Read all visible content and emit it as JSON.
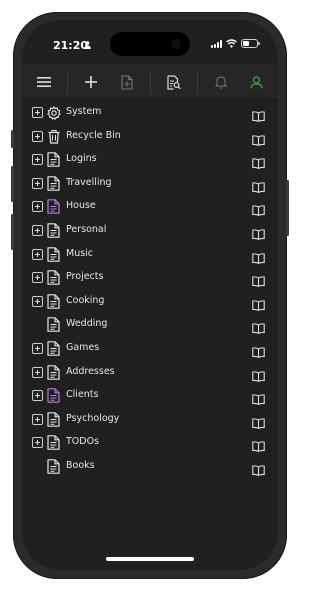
{
  "status_bar": {
    "time": "21:20",
    "icons": [
      "person-icon",
      "signal-icon",
      "wifi-icon",
      "battery-icon"
    ],
    "battery_level": 0.45
  },
  "toolbar": {
    "buttons": [
      {
        "name": "menu-button",
        "icon": "hamburger-icon"
      },
      {
        "name": "add-button",
        "icon": "plus-icon"
      },
      {
        "name": "new-note-button",
        "icon": "document-plus-icon"
      },
      {
        "name": "search-notes-button",
        "icon": "document-search-icon"
      },
      {
        "name": "notifications-button",
        "icon": "bell-icon"
      },
      {
        "name": "account-button",
        "icon": "user-icon"
      }
    ],
    "accent_color": "#2e9e45"
  },
  "tree": {
    "items": [
      {
        "label": "System",
        "icon": "gear-icon",
        "expandable": true
      },
      {
        "label": "Recycle Bin",
        "icon": "trash-icon",
        "expandable": true
      },
      {
        "label": "Logins",
        "icon": "document-icon",
        "expandable": true
      },
      {
        "label": "Travelling",
        "icon": "document-icon",
        "expandable": true
      },
      {
        "label": "House",
        "icon": "document-icon",
        "expandable": true,
        "icon_color": "#b57be0"
      },
      {
        "label": "Personal",
        "icon": "document-icon",
        "expandable": true
      },
      {
        "label": "Music",
        "icon": "document-icon",
        "expandable": true
      },
      {
        "label": "Projects",
        "icon": "document-icon",
        "expandable": true
      },
      {
        "label": "Cooking",
        "icon": "document-icon",
        "expandable": true
      },
      {
        "label": "Wedding",
        "icon": "document-icon",
        "expandable": false
      },
      {
        "label": "Games",
        "icon": "document-icon",
        "expandable": true
      },
      {
        "label": "Addresses",
        "icon": "document-icon",
        "expandable": true
      },
      {
        "label": "Clients",
        "icon": "document-icon",
        "expandable": true,
        "icon_color": "#b57be0"
      },
      {
        "label": "Psychology",
        "icon": "document-icon",
        "expandable": true
      },
      {
        "label": "TODOs",
        "icon": "document-icon",
        "expandable": true
      },
      {
        "label": "Books",
        "icon": "document-icon",
        "expandable": false
      }
    ],
    "row_action_icon": "book-open-icon",
    "text_color": "#e6e6e6",
    "default_icon_color": "#e6e6e6"
  },
  "theme": {
    "screen_bg": "#202020",
    "toolbar_bg": "#262626"
  }
}
